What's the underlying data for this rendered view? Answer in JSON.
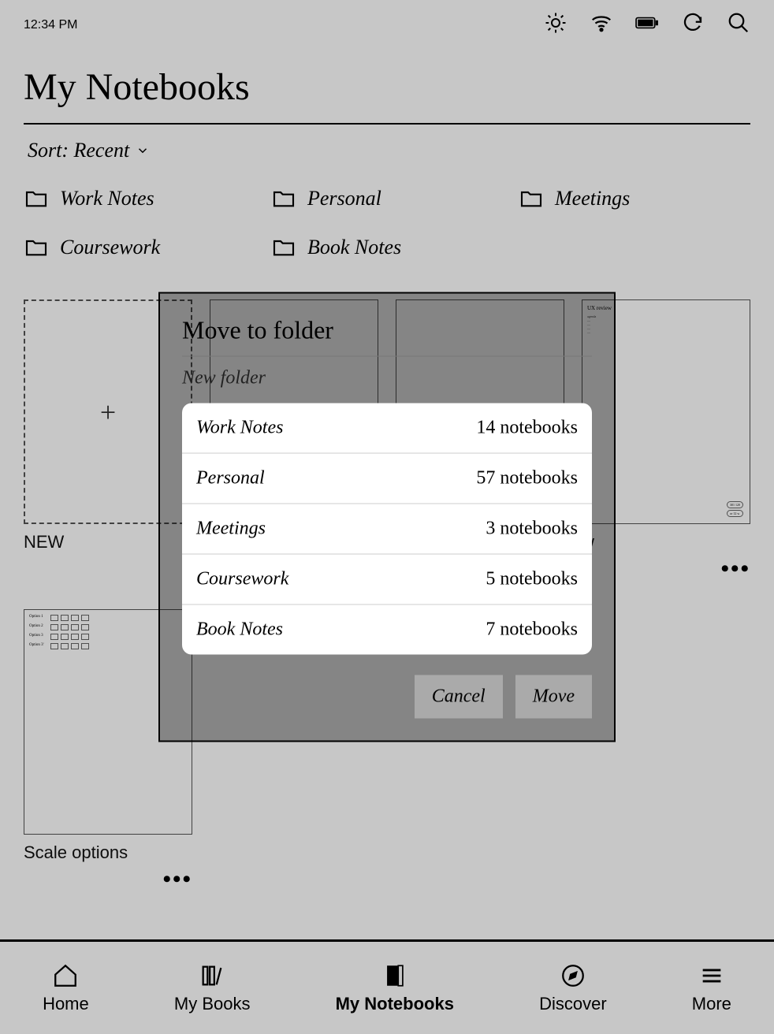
{
  "status": {
    "time": "12:34 PM"
  },
  "page": {
    "title": "My Notebooks",
    "sort_label": "Sort: Recent"
  },
  "folders": [
    {
      "label": "Work Notes"
    },
    {
      "label": "Personal"
    },
    {
      "label": "Meetings"
    },
    {
      "label": "Coursework"
    },
    {
      "label": "Book Notes"
    }
  ],
  "notebooks": {
    "new_label": "NEW",
    "items": [
      {
        "label": ""
      },
      {
        "label": ""
      },
      {
        "label": "w",
        "label_suffix": ""
      }
    ],
    "row2": [
      {
        "label": "Scale options"
      }
    ]
  },
  "dialog": {
    "title": "Move to folder",
    "new_folder": "New folder",
    "rows": [
      {
        "name": "Work Notes",
        "count": "14 notebooks"
      },
      {
        "name": "Personal",
        "count": "57 notebooks"
      },
      {
        "name": "Meetings",
        "count": "3 notebooks"
      },
      {
        "name": "Coursework",
        "count": "5 notebooks"
      },
      {
        "name": "Book Notes",
        "count": "7 notebooks"
      }
    ],
    "cancel": "Cancel",
    "move": "Move"
  },
  "tabs": {
    "home": "Home",
    "my_books": "My Books",
    "my_notebooks": "My Notebooks",
    "discover": "Discover",
    "more": "More"
  }
}
